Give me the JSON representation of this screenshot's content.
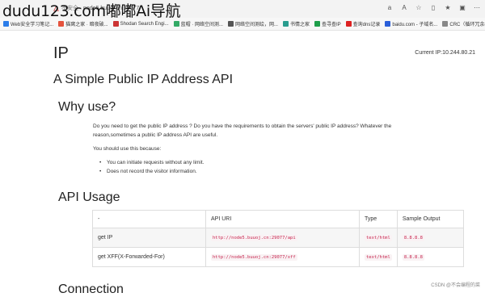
{
  "watermark": "dudu123.com嘟嘟Ai导航",
  "address_bar": {
    "insecure_label": "不安全",
    "url": "node5.buuoj.cn:29077"
  },
  "toolbar_icons": [
    "reader-icon",
    "translate-icon",
    "star-icon",
    "split-icon",
    "favorites-icon",
    "collections-icon",
    "more-icon"
  ],
  "bookmarks": [
    {
      "label": "Web安全学习笔记...",
      "color": "#2b7de9"
    },
    {
      "label": "猫窝之家 · 暗夜破...",
      "color": "#e5533d"
    },
    {
      "label": "Shodan Search Engi...",
      "color": "#c33"
    },
    {
      "label": "蓝帽 · 网络空间测...",
      "color": "#3a6"
    },
    {
      "label": "网络空间测绘，网...",
      "color": "#555"
    },
    {
      "label": "书情之家",
      "color": "#2a9d8f"
    },
    {
      "label": "查寻查IP",
      "color": "#1e9e4a"
    },
    {
      "label": "查询dns记录",
      "color": "#d22"
    },
    {
      "label": "baidu.com - 子域名...",
      "color": "#2b5fd9"
    },
    {
      "label": "CRC（循环冗余校...",
      "color": "#888"
    }
  ],
  "page": {
    "title": "IP",
    "current_ip": "Current IP:10.244.80.21",
    "subtitle": "A Simple Public IP Address API",
    "why_heading": "Why use?",
    "why_paragraph": "Do you need to get the public IP address ? Do you have the requirements to obtain the servers' public IP address? Whatever the reason,sometimes a public IP address API are useful.",
    "should_text": "You should use this because:",
    "bullets": [
      "You can initiate requests without any limit.",
      "Does not record the visitor information."
    ],
    "api_heading": "API Usage",
    "next_heading": "Connection"
  },
  "api_table": {
    "headers": [
      "-",
      "API URI",
      "Type",
      "Sample Output"
    ],
    "rows": [
      [
        "get IP",
        "http://node5.buuoj.cn:29077/api",
        "text/html",
        "8.8.8.8"
      ],
      [
        "get XFF(X-Forwarded-For)",
        "http://node5.buuoj.cn:29077/xff",
        "text/html",
        "8.8.8.8"
      ]
    ]
  },
  "footer_watermark": "CSDN @不会编程的菜"
}
